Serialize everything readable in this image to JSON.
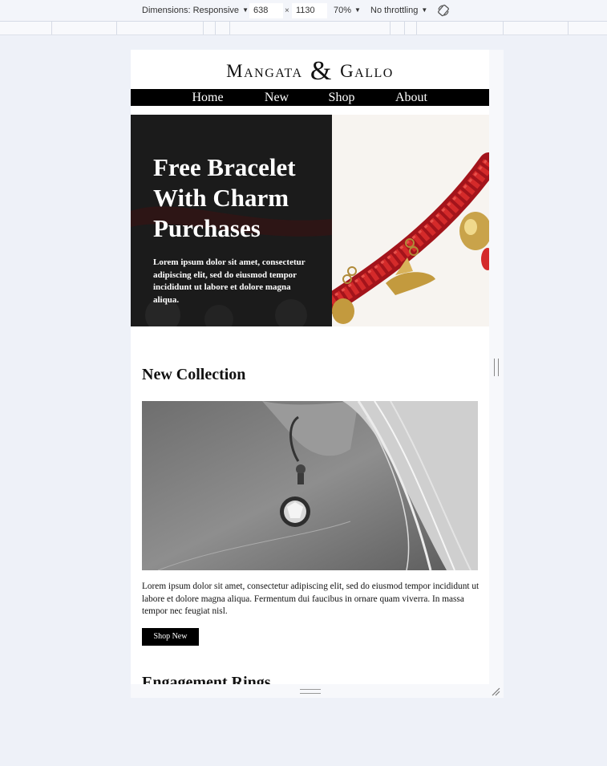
{
  "devtools": {
    "dimensions_label": "Dimensions: Responsive",
    "width": "638",
    "times": "×",
    "height": "1130",
    "zoom": "70%",
    "throttling": "No throttling",
    "caret": "▼"
  },
  "site": {
    "logo_part1": "Mangata",
    "logo_amp": "&",
    "logo_part2": "Gallo",
    "nav": [
      "Home",
      "New",
      "Shop",
      "About"
    ]
  },
  "hero": {
    "title": "Free Bracelet With Charm Purchases",
    "text": "Lorem ipsum dolor sit amet, consectetur adipiscing elit, sed do eiusmod tempor incididunt ut labore et dolore magna aliqua."
  },
  "collection": {
    "title": "New Collection",
    "text": "Lorem ipsum dolor sit amet, consectetur adipiscing elit, sed do eiusmod tempor incididunt ut labore et dolore magna aliqua. Fermentum dui faucibus in ornare quam viverra. In massa tempor nec feugiat nisl.",
    "button": "Shop New"
  },
  "next_section": {
    "title": "Engagement Rings"
  },
  "colors": {
    "nav_bg": "#000000",
    "hero_panel": "#1c1c1c",
    "accent_red": "#c41e1e",
    "gold": "#c9a34a"
  }
}
